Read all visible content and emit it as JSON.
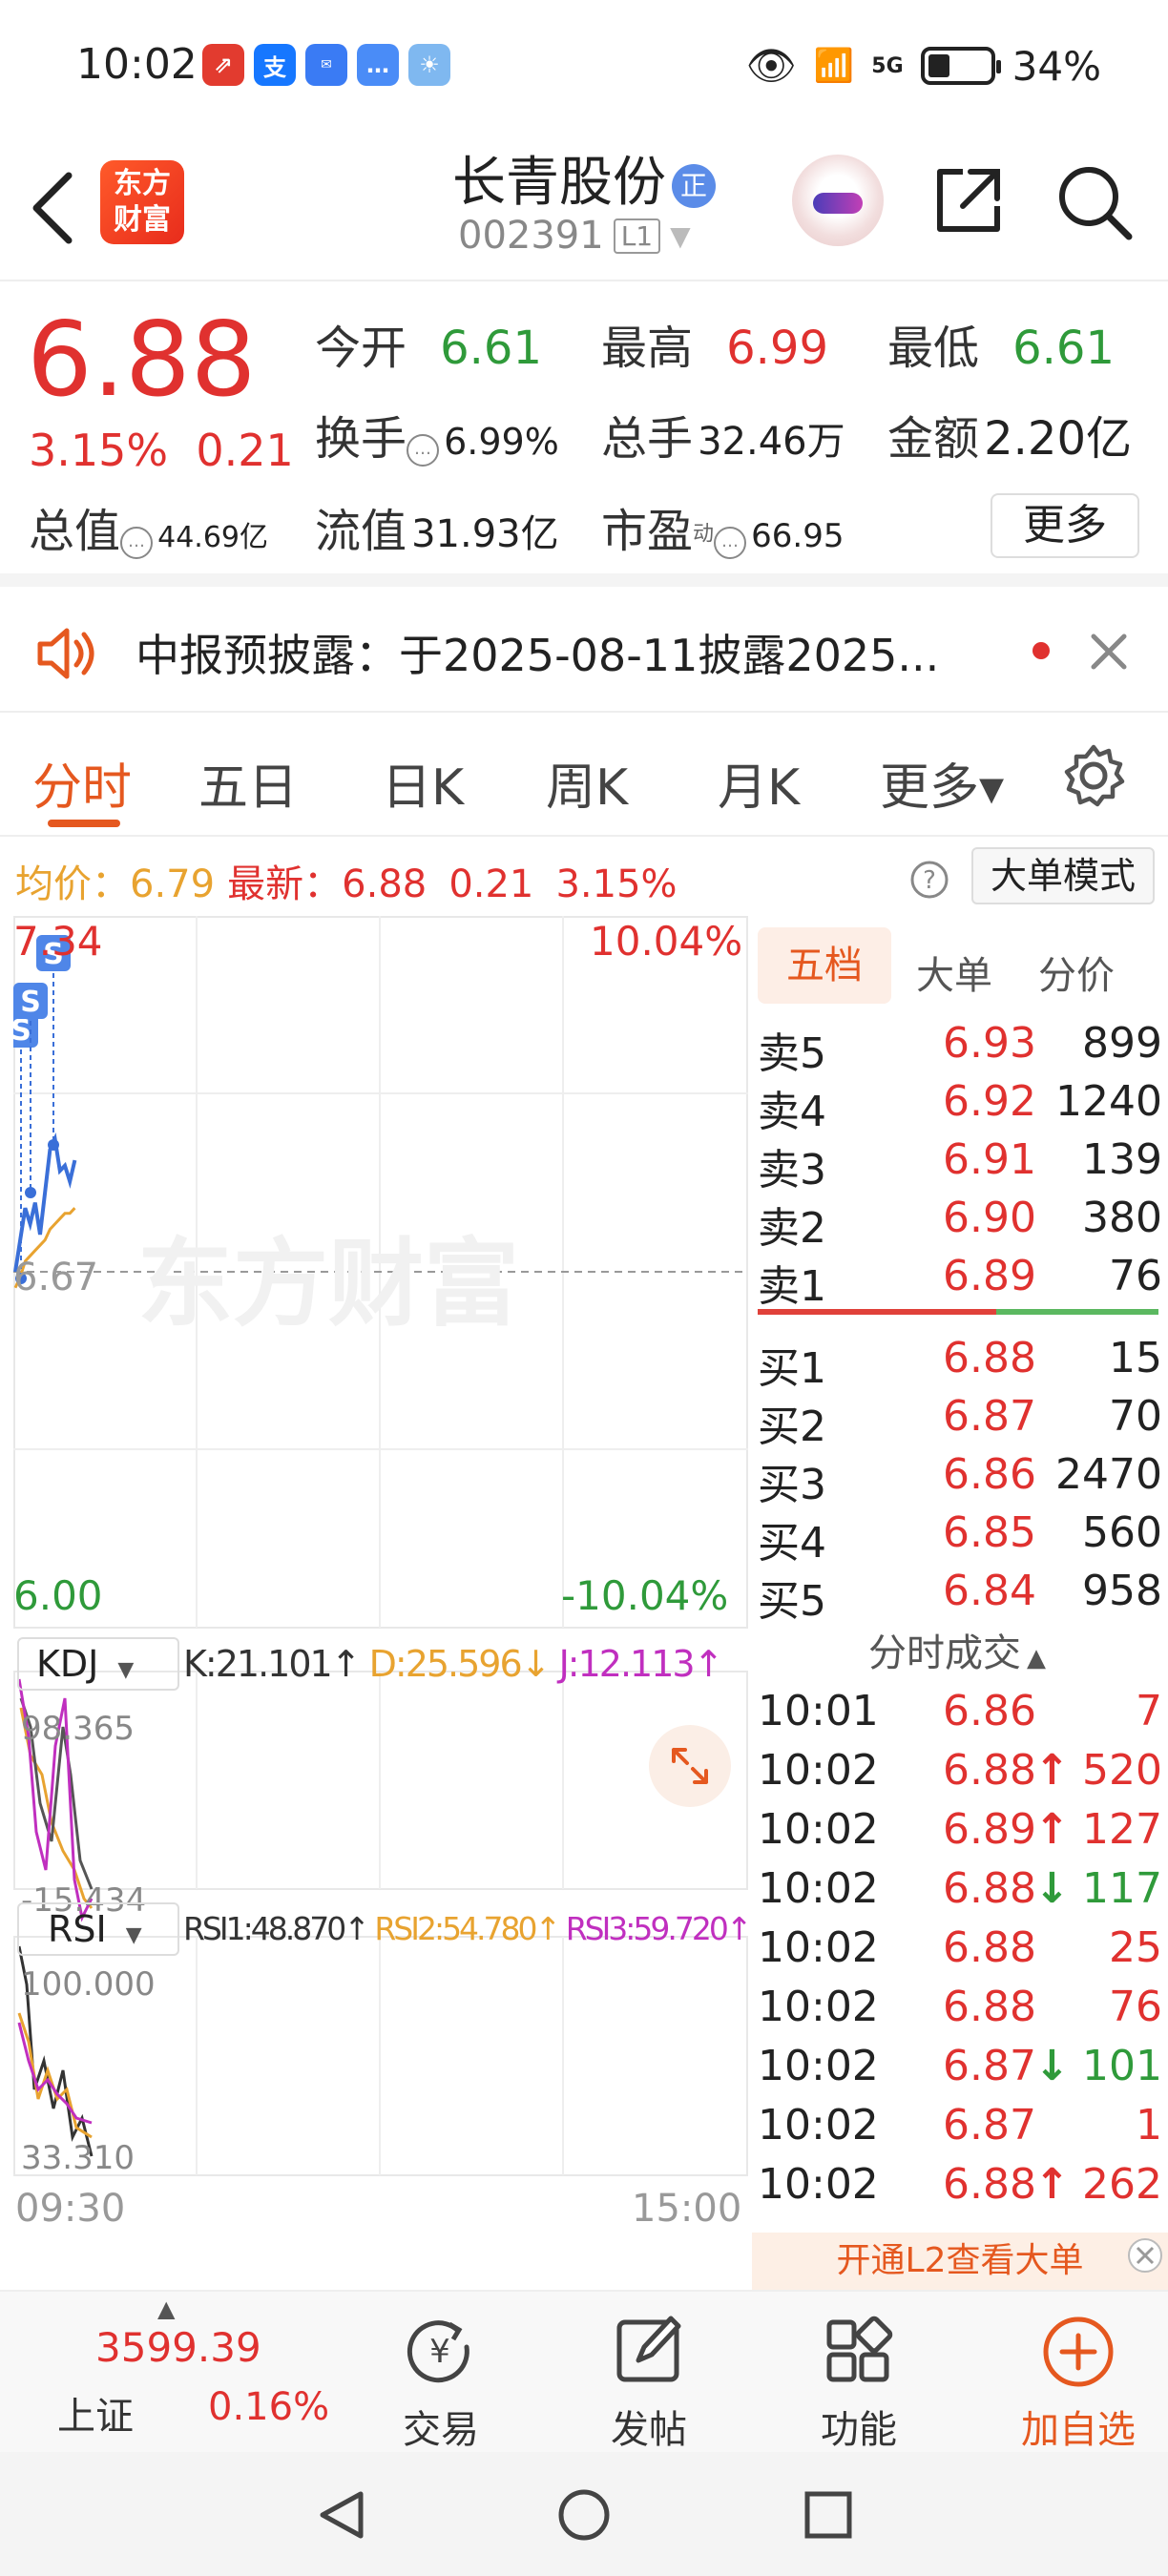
{
  "status_bar": {
    "time": "10:02",
    "app_icons": [
      "stock-app-icon",
      "alipay-icon",
      "honor-icon",
      "messages-icon",
      "weather-icon"
    ],
    "network": "5G",
    "battery": "34%"
  },
  "header": {
    "logo_line1": "东方",
    "logo_line2": "财富",
    "stock_name": "长青股份",
    "badge": "正",
    "stock_code": "002391",
    "level": "L1"
  },
  "quote": {
    "price": "6.88",
    "change_pct": "3.15%",
    "change_amt": "0.21",
    "open_label": "今开",
    "open": "6.61",
    "high_label": "最高",
    "high": "6.99",
    "low_label": "最低",
    "low": "6.61",
    "turnover_label": "换手",
    "turnover": "6.99%",
    "volume_label": "总手",
    "volume": "32.46万",
    "amount_label": "金额",
    "amount": "2.20亿",
    "mktcap_label": "总值",
    "mktcap": "44.69亿",
    "float_label": "流值",
    "float_cap": "31.93亿",
    "pe_label": "市盈",
    "pe_sup": "动",
    "pe": "66.95",
    "more_label": "更多"
  },
  "notice": {
    "text": "中报预披露：于2025-08-11披露2025..."
  },
  "tabs": [
    "分时",
    "五日",
    "日K",
    "周K",
    "月K",
    "更多▾"
  ],
  "chart_info": {
    "avg_label": "均价：",
    "avg": "6.79",
    "latest_label": "最新：",
    "latest": "6.88",
    "chg": "0.21",
    "chg_pct": "3.15%",
    "big_order_btn": "大单模式"
  },
  "chart": {
    "y_top": "7.34",
    "pct_top": "10.04%",
    "y_mid": "6.67",
    "y_bottom": "6.00",
    "pct_bottom": "-10.04%",
    "watermark": "东方财富",
    "signal_label": "S",
    "kdj_label": "KDJ",
    "kdj_k": "K:21.101↑",
    "kdj_d": "D:25.596↓",
    "kdj_j": "J:12.113↑",
    "kdj_top": "98.365",
    "kdj_bottom": "-15.434",
    "rsi_label": "RSI",
    "rsi1": "RSI1:48.870↑",
    "rsi2": "RSI2:54.780↑",
    "rsi3": "RSI3:59.720↑",
    "rsi_top": "100.000",
    "rsi_bottom": "33.310",
    "time_start": "09:30",
    "time_end": "15:00"
  },
  "chart_data": {
    "type": "line",
    "series": [
      {
        "values": [
          6.67,
          6.73,
          6.79,
          6.76,
          6.8,
          6.74,
          6.82,
          6.9,
          6.92,
          6.86,
          6.87,
          6.84,
          6.88
        ]
      },
      {
        "values": [
          6.64,
          6.66,
          6.69,
          6.7,
          6.71,
          6.72,
          6.73,
          6.75,
          6.76,
          6.77,
          6.78,
          6.78,
          6.79
        ]
      }
    ],
    "ylim": [
      6.0,
      7.34
    ]
  },
  "order_book": {
    "tabs": [
      "五档",
      "大单",
      "分价"
    ],
    "asks": [
      {
        "label": "卖5",
        "price": "6.93",
        "vol": "899"
      },
      {
        "label": "卖4",
        "price": "6.92",
        "vol": "1240"
      },
      {
        "label": "卖3",
        "price": "6.91",
        "vol": "139"
      },
      {
        "label": "卖2",
        "price": "6.90",
        "vol": "380"
      },
      {
        "label": "卖1",
        "price": "6.89",
        "vol": "76"
      }
    ],
    "bids": [
      {
        "label": "买1",
        "price": "6.88",
        "vol": "15"
      },
      {
        "label": "买2",
        "price": "6.87",
        "vol": "70"
      },
      {
        "label": "买3",
        "price": "6.86",
        "vol": "2470"
      },
      {
        "label": "买4",
        "price": "6.85",
        "vol": "560"
      },
      {
        "label": "买5",
        "price": "6.84",
        "vol": "958"
      }
    ],
    "ticks_title": "分时成交",
    "ticks": [
      {
        "time": "10:01",
        "price": "6.86",
        "dir": "",
        "vol": "7",
        "color": "red"
      },
      {
        "time": "10:02",
        "price": "6.88",
        "dir": "↑",
        "vol": "520",
        "color": "red"
      },
      {
        "time": "10:02",
        "price": "6.89",
        "dir": "↑",
        "vol": "127",
        "color": "red"
      },
      {
        "time": "10:02",
        "price": "6.88",
        "dir": "↓",
        "vol": "117",
        "color": "green"
      },
      {
        "time": "10:02",
        "price": "6.88",
        "dir": "",
        "vol": "25",
        "color": "red"
      },
      {
        "time": "10:02",
        "price": "6.88",
        "dir": "",
        "vol": "76",
        "color": "red"
      },
      {
        "time": "10:02",
        "price": "6.87",
        "dir": "↓",
        "vol": "101",
        "color": "green"
      },
      {
        "time": "10:02",
        "price": "6.87",
        "dir": "",
        "vol": "1",
        "color": "red"
      },
      {
        "time": "10:02",
        "price": "6.88",
        "dir": "↑",
        "vol": "262",
        "color": "red"
      }
    ],
    "l2_banner": "开通L2查看大单"
  },
  "bottom_nav": {
    "index_value": "3599.39",
    "index_name": "上证",
    "index_chg": "0.16%",
    "items": [
      "交易",
      "发帖",
      "功能",
      "加自选"
    ]
  }
}
